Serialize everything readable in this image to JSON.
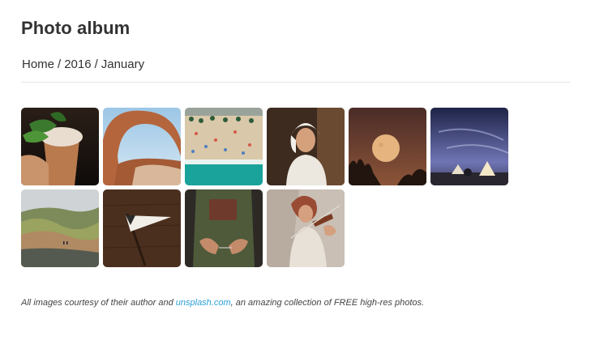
{
  "page": {
    "title": "Photo album"
  },
  "breadcrumb": {
    "items": [
      "Home",
      "2016",
      "January"
    ],
    "separator": "/"
  },
  "gallery": {
    "photos": [
      {
        "subject": "mint julep cocktail"
      },
      {
        "subject": "natural rock arch"
      },
      {
        "subject": "aerial beach with umbrellas"
      },
      {
        "subject": "woman in headscarf"
      },
      {
        "subject": "full moon over trees"
      },
      {
        "subject": "tents under night sky"
      },
      {
        "subject": "green hills landscape"
      },
      {
        "subject": "explore pennant flag"
      },
      {
        "subject": "craftsman with apron"
      },
      {
        "subject": "woman playing violin"
      }
    ]
  },
  "footer": {
    "caption_before": "All images courtesy of their author and ",
    "link_text": "unsplash.com",
    "caption_after": ", an amazing collection of FREE high-res photos.",
    "link_color": "#2a9fd6"
  }
}
